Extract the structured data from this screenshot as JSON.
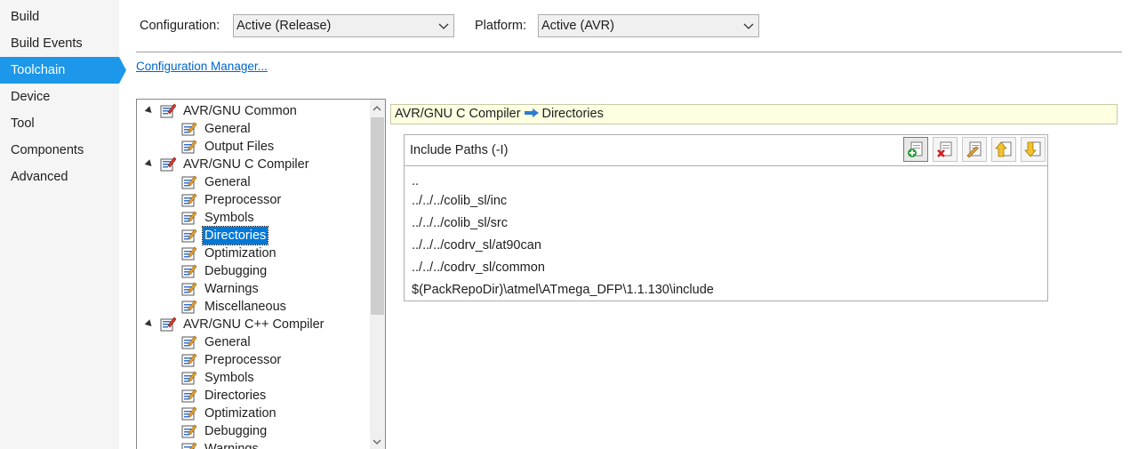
{
  "nav": {
    "items": [
      {
        "label": "Build"
      },
      {
        "label": "Build Events"
      },
      {
        "label": "Toolchain",
        "active": true
      },
      {
        "label": "Device"
      },
      {
        "label": "Tool"
      },
      {
        "label": "Components"
      },
      {
        "label": "Advanced"
      }
    ]
  },
  "config": {
    "configuration_label": "Configuration:",
    "configuration_value": "Active (Release)",
    "platform_label": "Platform:",
    "platform_value": "Active (AVR)",
    "manager_link": "Configuration Manager..."
  },
  "tree": {
    "nodes": [
      {
        "label": "AVR/GNU Common",
        "level": 0
      },
      {
        "label": "General",
        "level": 1
      },
      {
        "label": "Output Files",
        "level": 1
      },
      {
        "label": "AVR/GNU C Compiler",
        "level": 0
      },
      {
        "label": "General",
        "level": 1
      },
      {
        "label": "Preprocessor",
        "level": 1
      },
      {
        "label": "Symbols",
        "level": 1
      },
      {
        "label": "Directories",
        "level": 1,
        "selected": true
      },
      {
        "label": "Optimization",
        "level": 1
      },
      {
        "label": "Debugging",
        "level": 1
      },
      {
        "label": "Warnings",
        "level": 1
      },
      {
        "label": "Miscellaneous",
        "level": 1
      },
      {
        "label": "AVR/GNU C++ Compiler",
        "level": 0
      },
      {
        "label": "General",
        "level": 1
      },
      {
        "label": "Preprocessor",
        "level": 1
      },
      {
        "label": "Symbols",
        "level": 1
      },
      {
        "label": "Directories",
        "level": 1
      },
      {
        "label": "Optimization",
        "level": 1
      },
      {
        "label": "Debugging",
        "level": 1
      },
      {
        "label": "Warnings",
        "level": 1
      }
    ]
  },
  "breadcrumb": {
    "part1": "AVR/GNU C Compiler",
    "separator_icon": "arrow-right-icon",
    "part2": "Directories"
  },
  "include_paths": {
    "title": "Include Paths (-I)",
    "toolbar": [
      "add-item-icon",
      "delete-item-icon",
      "edit-item-icon",
      "move-up-icon",
      "move-down-icon"
    ],
    "items": [
      "..",
      "../../../colib_sl/inc",
      "../../../colib_sl/src",
      "../../../codrv_sl/at90can",
      "../../../codrv_sl/common",
      "$(PackRepoDir)\\atmel\\ATmega_DFP\\1.1.130\\include"
    ]
  }
}
